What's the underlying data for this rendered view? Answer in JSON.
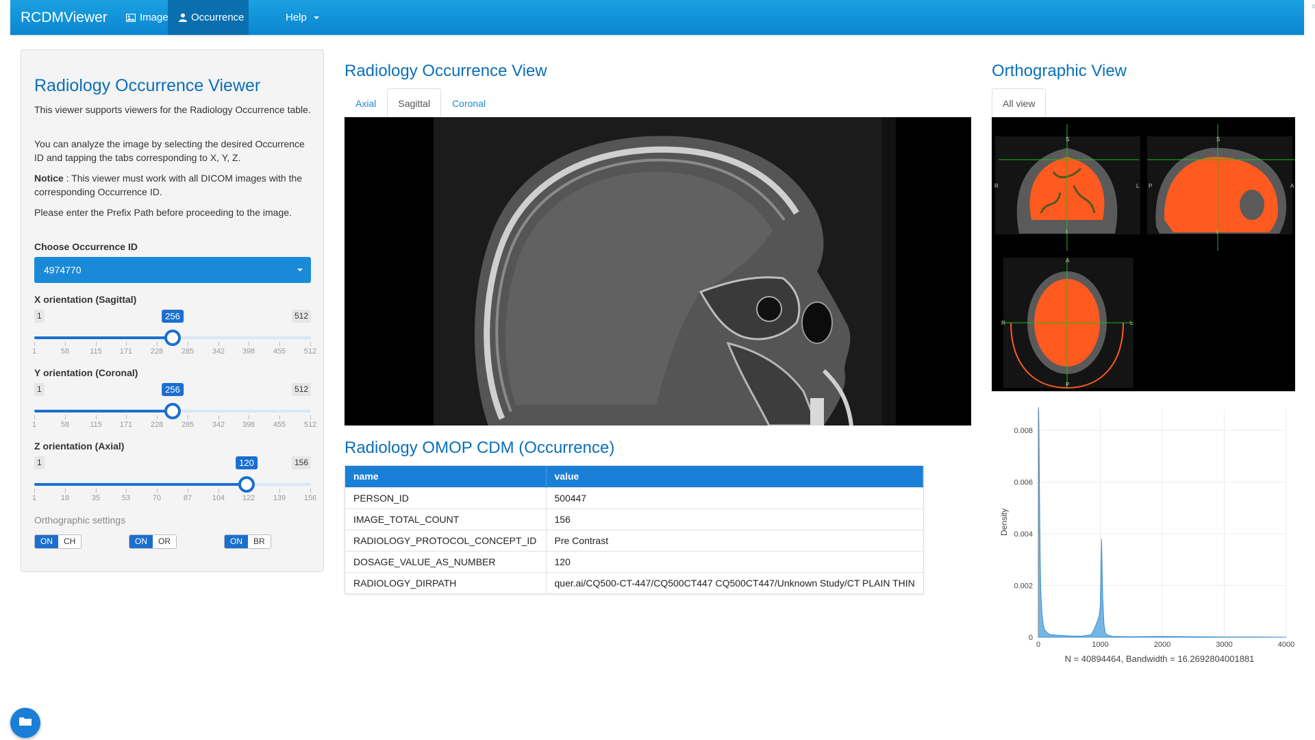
{
  "navbar": {
    "brand": "RCDMViewer",
    "items": [
      {
        "label": "Image",
        "icon": "image-icon"
      },
      {
        "label": "Occurrence",
        "icon": "user-icon"
      },
      {
        "label": "Help",
        "icon": "caret-down-icon"
      }
    ],
    "active": "Occurrence"
  },
  "sidebar": {
    "title": "Radiology Occurrence Viewer",
    "p1": "This viewer supports viewers for the Radiology Occurrence table.",
    "p2": "You can analyze the image by selecting the desired Occurrence ID and tapping the tabs corresponding to X, Y, Z.",
    "notice_label": "Notice",
    "notice_text": " : This viewer must work with all DICOM images with the corresponding Occurrence ID.",
    "p4": "Please enter the Prefix Path before proceeding to the image.",
    "choose_label": "Choose Occurrence ID",
    "occurrence_id": "4974770",
    "sliders": [
      {
        "label": "X orientation (Sagittal)",
        "min": 1,
        "max": 512,
        "value": 256,
        "ticks": [
          "1",
          "58",
          "115",
          "171",
          "228",
          "285",
          "342",
          "398",
          "455",
          "512"
        ]
      },
      {
        "label": "Y orientation (Coronal)",
        "min": 1,
        "max": 512,
        "value": 256,
        "ticks": [
          "1",
          "58",
          "115",
          "171",
          "228",
          "285",
          "342",
          "398",
          "455",
          "512"
        ]
      },
      {
        "label": "Z orientation (Axial)",
        "min": 1,
        "max": 156,
        "value": 120,
        "ticks": [
          "1",
          "18",
          "35",
          "53",
          "70",
          "87",
          "104",
          "122",
          "139",
          "156"
        ]
      }
    ],
    "ortho_settings_label": "Orthographic settings",
    "toggles": [
      {
        "on": "ON",
        "off": "CH"
      },
      {
        "on": "ON",
        "off": "OR"
      },
      {
        "on": "ON",
        "off": "BR"
      }
    ]
  },
  "center": {
    "title": "Radiology Occurrence View",
    "tabs": [
      "Axial",
      "Sagittal",
      "Coronal"
    ],
    "active_tab": "Sagittal",
    "omop_title": "Radiology OMOP CDM (Occurrence)",
    "table_headers": [
      "name",
      "value"
    ],
    "table_rows": [
      [
        "PERSON_ID",
        "500447"
      ],
      [
        "IMAGE_TOTAL_COUNT",
        "156"
      ],
      [
        "RADIOLOGY_PROTOCOL_CONCEPT_ID",
        "Pre Contrast"
      ],
      [
        "DOSAGE_VALUE_AS_NUMBER",
        "120"
      ],
      [
        "RADIOLOGY_DIRPATH",
        "quer.ai/CQ500-CT-447/CQ500CT447 CQ500CT447/Unknown Study/CT PLAIN THIN"
      ]
    ]
  },
  "right": {
    "title": "Orthographic View",
    "tab": "All view",
    "ortho_labels": {
      "S": "S",
      "I": "I",
      "R": "R",
      "L": "L",
      "A": "A",
      "P": "P"
    },
    "density_caption": "N = 40894464, Bandwidth = 16.2692804001881"
  },
  "chart_data": {
    "type": "area",
    "title": "",
    "xlabel": "",
    "ylabel": "Density",
    "xlim": [
      0,
      4000
    ],
    "ylim": [
      0,
      0.0088
    ],
    "xticks": [
      0,
      1000,
      2000,
      3000,
      4000
    ],
    "yticks": [
      0,
      0.002,
      0.004,
      0.006,
      0.008
    ],
    "ytick_labels": [
      "0",
      "0.002",
      "0.004",
      "0.006",
      "0.008"
    ],
    "grid": true,
    "series": [
      {
        "x": [
          0,
          5,
          10,
          20,
          30,
          40,
          60,
          80,
          100,
          150,
          200,
          300,
          500,
          700,
          850,
          900,
          950,
          980,
          1000,
          1020,
          1040,
          1060,
          1080,
          1100,
          1200,
          1500,
          2000,
          2500,
          3000,
          3500,
          4000
        ],
        "y": [
          0.0002,
          0.0089,
          0.0082,
          0.0055,
          0.0032,
          0.0018,
          0.0009,
          0.0005,
          0.0003,
          0.00015,
          0.0001,
          8e-05,
          5e-05,
          4e-05,
          0.0001,
          0.0003,
          0.0006,
          0.0008,
          0.0012,
          0.0038,
          0.0015,
          0.0005,
          0.0002,
          0.0001,
          3e-05,
          2e-05,
          3e-05,
          2e-05,
          1e-05,
          1e-05,
          0.0
        ]
      }
    ],
    "color": "#5ca9e0"
  }
}
